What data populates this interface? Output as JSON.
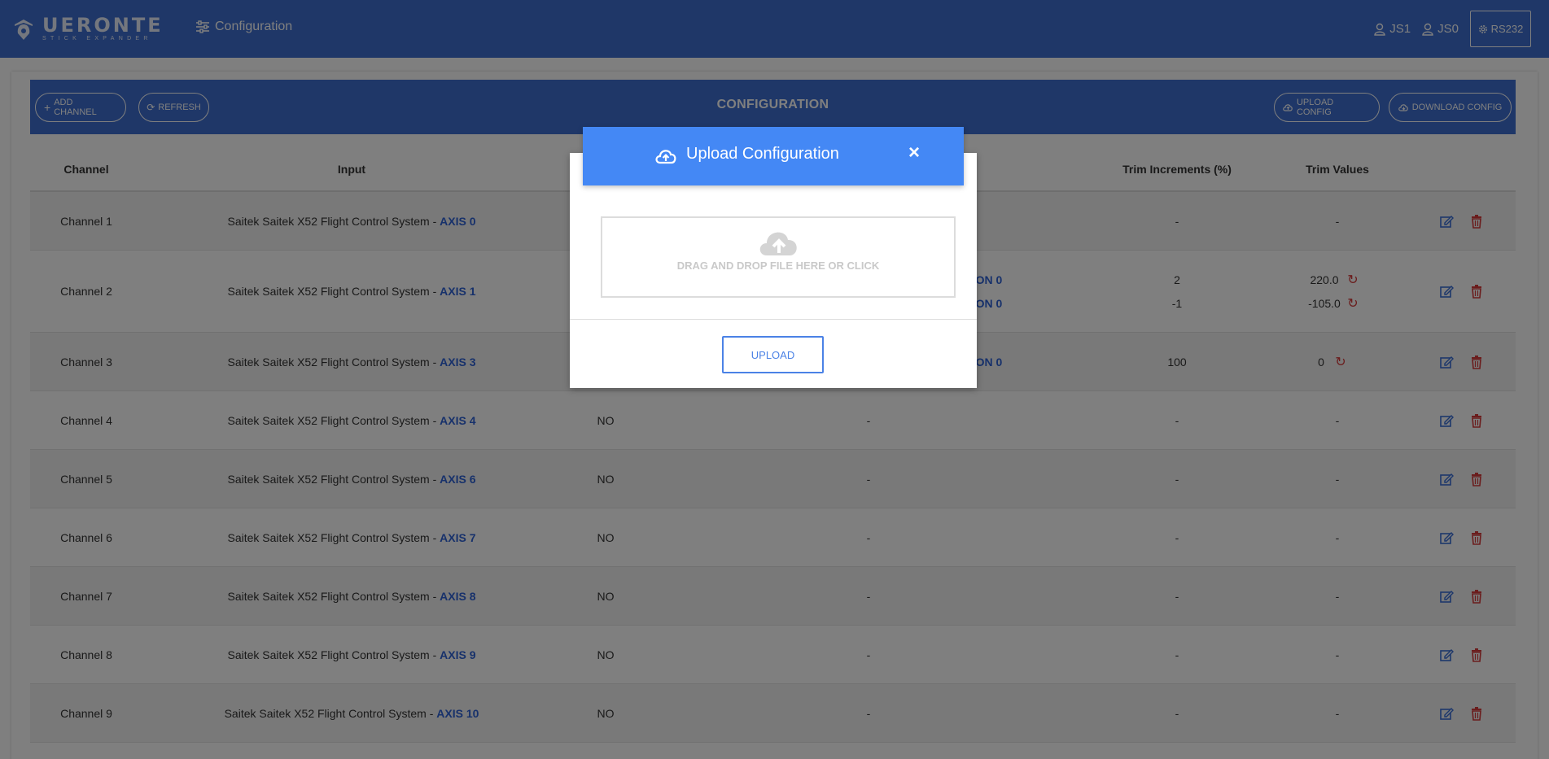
{
  "header": {
    "brand": "UERONTE",
    "brand_sub": "STICK EXPANDER",
    "nav_label": "Configuration",
    "js1": "JS1",
    "js0": "JS0",
    "rs232": "RS232"
  },
  "toolbar": {
    "add_channel": "ADD CHANNEL",
    "refresh": "REFRESH",
    "title": "CONFIGURATION",
    "upload_config": "UPLOAD CONFIG",
    "download_config": "DOWNLOAD CONFIG"
  },
  "table": {
    "headers": {
      "channel": "Channel",
      "input": "Input",
      "trim_increments": "Trim Increments (%)",
      "trim_values": "Trim Values"
    },
    "input_prefix": "Saitek Saitek X52 Flight Control System - ",
    "rows": [
      {
        "channel": "Channel 1",
        "axis": "AXIS 0",
        "col3": "",
        "col4": "",
        "trim_inc": "-",
        "trim_val": "-"
      },
      {
        "channel": "Channel 2",
        "axis": "AXIS 1",
        "col3": "",
        "col4a": "ON 0",
        "col4b": "ON 0",
        "trim_inc_a": "2",
        "trim_inc_b": "-1",
        "trim_val_a": "220.0",
        "trim_val_b": "-105.0"
      },
      {
        "channel": "Channel 3",
        "axis": "AXIS 3",
        "col3": "",
        "col4": "ON 0",
        "trim_inc": "100",
        "trim_val": "0"
      },
      {
        "channel": "Channel 4",
        "axis": "AXIS 4",
        "col3": "NO",
        "col4": "-",
        "trim_inc": "-",
        "trim_val": "-"
      },
      {
        "channel": "Channel 5",
        "axis": "AXIS 6",
        "col3": "NO",
        "col4": "-",
        "trim_inc": "-",
        "trim_val": "-"
      },
      {
        "channel": "Channel 6",
        "axis": "AXIS 7",
        "col3": "NO",
        "col4": "-",
        "trim_inc": "-",
        "trim_val": "-"
      },
      {
        "channel": "Channel 7",
        "axis": "AXIS 8",
        "col3": "NO",
        "col4": "-",
        "trim_inc": "-",
        "trim_val": "-"
      },
      {
        "channel": "Channel 8",
        "axis": "AXIS 9",
        "col3": "NO",
        "col4": "-",
        "trim_inc": "-",
        "trim_val": "-"
      },
      {
        "channel": "Channel 9",
        "axis": "AXIS 10",
        "col3": "NO",
        "col4": "-",
        "trim_inc": "-",
        "trim_val": "-"
      }
    ]
  },
  "modal": {
    "title": "Upload Configuration",
    "close": "×",
    "dropzone_text": "DRAG AND DROP FILE HERE OR CLICK",
    "upload_button": "UPLOAD"
  },
  "colors": {
    "primary": "#3f6fd0",
    "modal_header": "#4488f5",
    "link_blue": "#2e62d6",
    "delete_red": "#d63a3a"
  }
}
